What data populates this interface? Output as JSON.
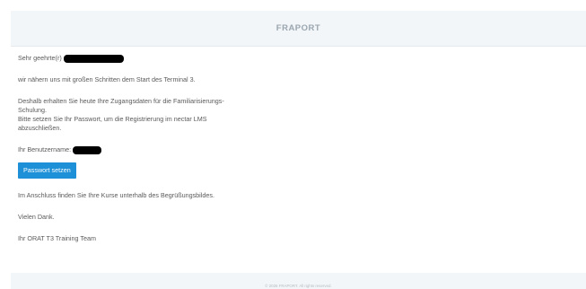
{
  "header": {
    "brand": "FRAPORT"
  },
  "email": {
    "greeting_prefix": "Sehr geehrte(r)",
    "intro": "wir nähern uns mit großen Schritten dem Start des Terminal 3.",
    "para1_line1": "Deshalb erhalten Sie heute Ihre Zugangsdaten für die Familiarisierungs-",
    "para1_line2": "Schulung.",
    "para1_line3": "Bitte setzen Sie Ihr Passwort, um die Registrierung im nectar LMS",
    "para1_line4": "abzuschließen.",
    "username_label": "Ihr Benutzername:",
    "button_label": "Passwort setzen",
    "after_button": "Im Anschluss finden Sie Ihre Kurse unterhalb des Begrüßungsbildes.",
    "thanks": "Vielen Dank.",
    "signature": "Ihr ORAT T3 Training Team"
  },
  "footer": {
    "copyright": "© 2026 FRAPORT. All rights reserved."
  },
  "colors": {
    "button": "#1e90d8",
    "header_bg": "#f3f6f8",
    "text": "#5a5a5a"
  }
}
